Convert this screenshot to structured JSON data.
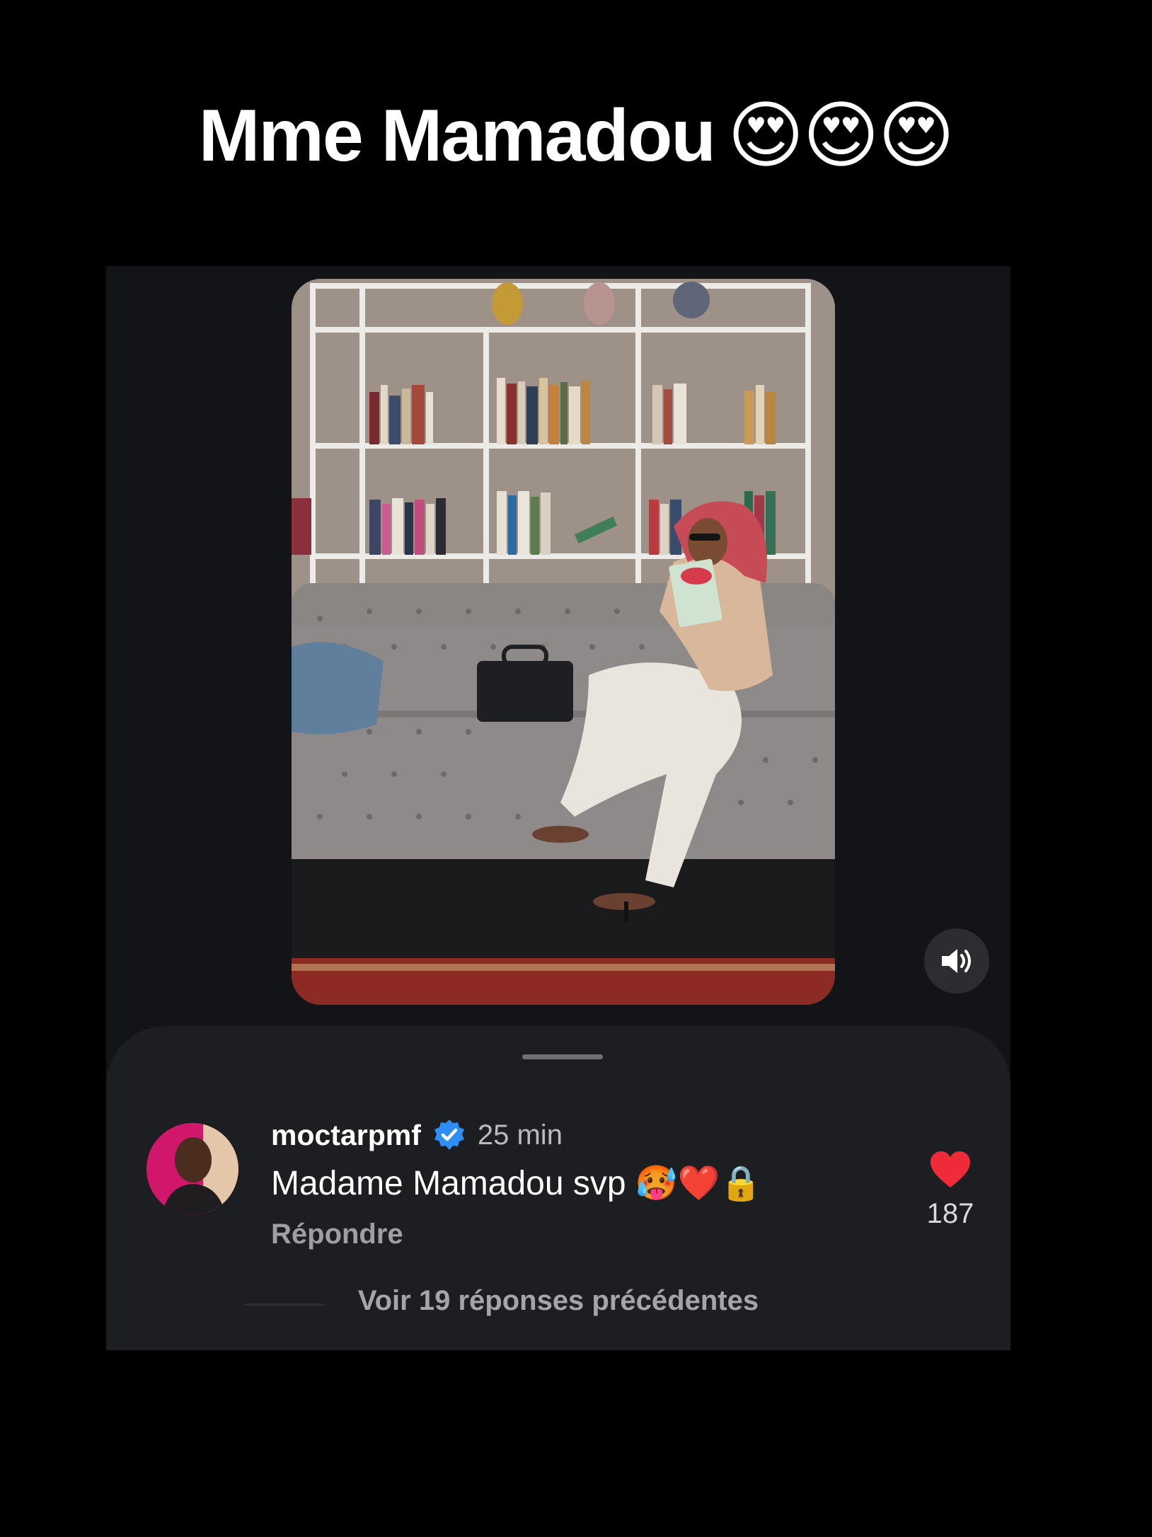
{
  "caption": {
    "text": "Mme Mamadou",
    "emojis": "😍😍😍"
  },
  "video": {
    "sound_icon": "speaker-volume-icon"
  },
  "comment": {
    "username": "moctarpmf",
    "verified_icon": "verified-badge-icon",
    "time": "25 min",
    "text": "Madame Mamadou svp 🥵❤️🔒",
    "reply_label": "Répondre",
    "like_count": "187",
    "like_icon": "heart-icon"
  },
  "view_replies_label": "Voir 19 réponses précédentes",
  "colors": {
    "background": "#000000",
    "sheet": "#1c1e22",
    "verified": "#2f8ef5",
    "heart": "#ef2b3a"
  }
}
